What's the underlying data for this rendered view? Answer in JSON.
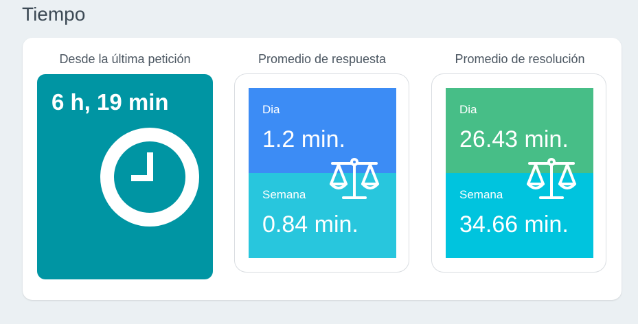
{
  "section": {
    "title": "Tiempo"
  },
  "last_request": {
    "label": "Desde la última petición",
    "value": "6 h, 19 min",
    "icon": "clock-icon",
    "color": "#0095a3"
  },
  "response_avg": {
    "label": "Promedio de respuesta",
    "day_label": "Dia",
    "day_value": "1.2 min.",
    "week_label": "Semana",
    "week_value": "0.84 min.",
    "icon": "scale-icon",
    "day_color": "#3c8cf5",
    "week_color": "#28c6dd"
  },
  "resolution_avg": {
    "label": "Promedio de resolución",
    "day_label": "Dia",
    "day_value": "26.43 min.",
    "week_label": "Semana",
    "week_value": "34.66 min.",
    "icon": "scale-icon",
    "day_color": "#47be87",
    "week_color": "#00c4de"
  }
}
